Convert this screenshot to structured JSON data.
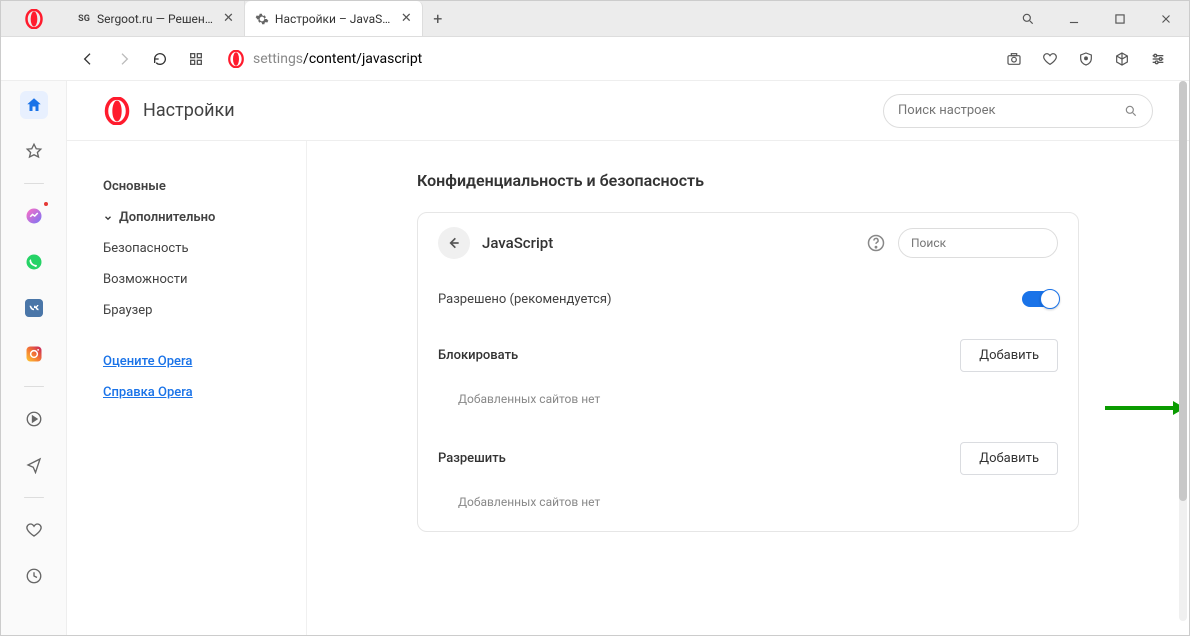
{
  "tabs": [
    {
      "title": "Sergoot.ru — Решение ва…",
      "favicon": "SG"
    },
    {
      "title": "Настройки – JavaScript",
      "favicon": "gear"
    }
  ],
  "address": {
    "protocol_part": "settings",
    "path_part": "/content/javascript"
  },
  "settings": {
    "title": "Настройки",
    "search_placeholder": "Поиск настроек",
    "nav": {
      "main": "Основные",
      "advanced": "Дополнительно",
      "security": "Безопасность",
      "features": "Возможности",
      "browser": "Браузер",
      "rate": "Оцените Opera",
      "help": "Справка Opera"
    },
    "panel": {
      "heading": "Конфиденциальность и безопасность",
      "page_title": "JavaScript",
      "search_placeholder": "Поиск",
      "allowed_label": "Разрешено (рекомендуется)",
      "block_section": "Блокировать",
      "allow_section": "Разрешить",
      "add_button": "Добавить",
      "empty_text": "Добавленных сайтов нет"
    }
  }
}
